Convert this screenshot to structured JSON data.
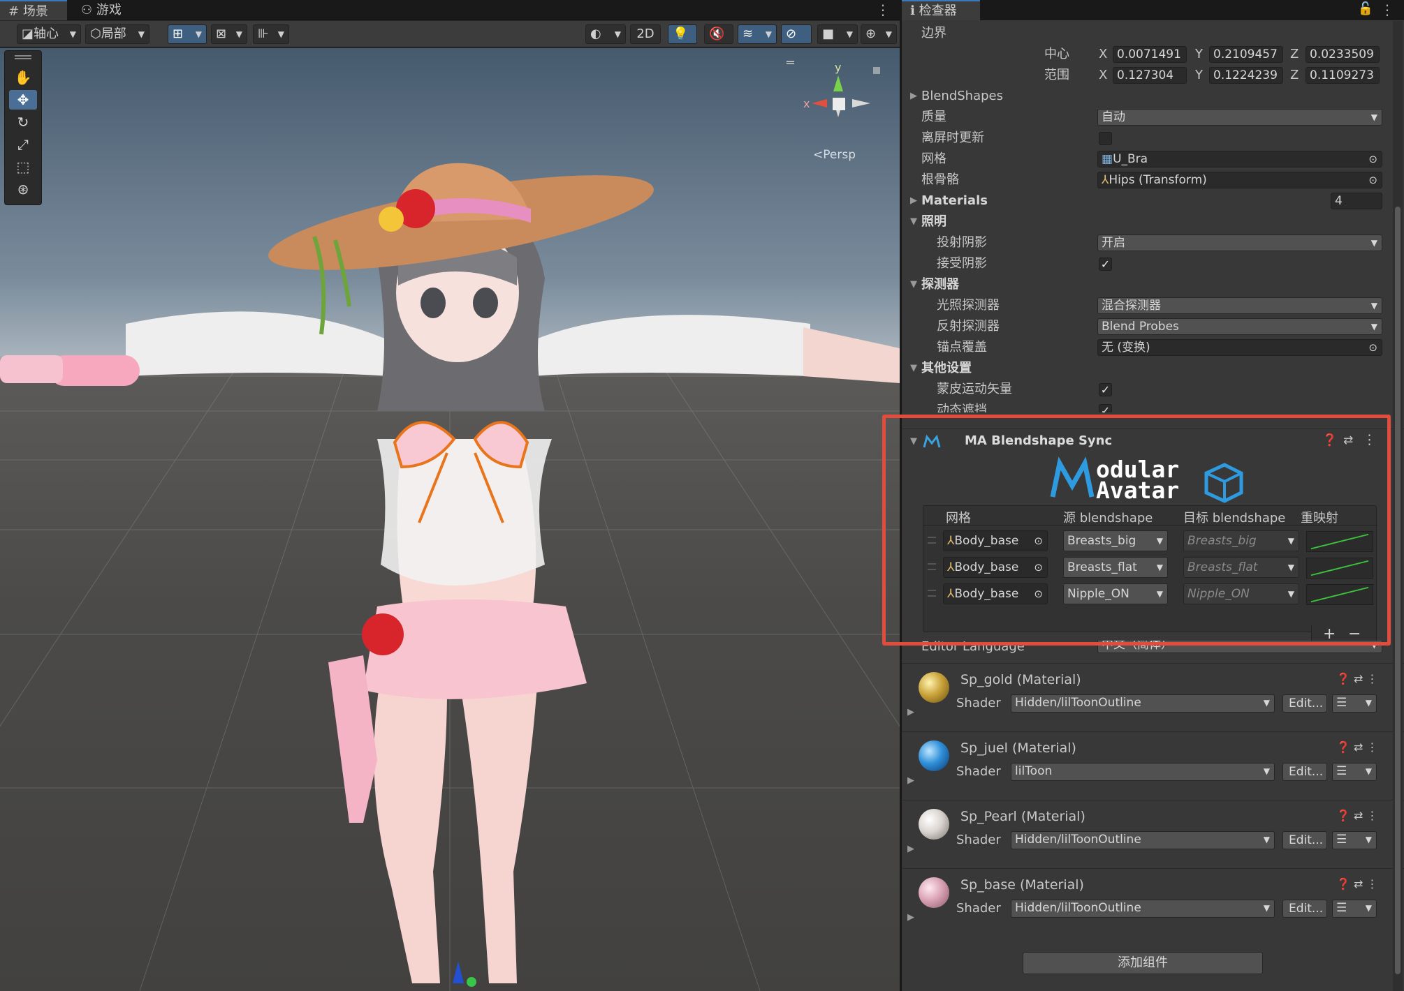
{
  "scene_tabs": {
    "scene": "场景",
    "game": "游戏"
  },
  "toolbar": {
    "pivot": "轴心",
    "local": "局部",
    "mode_2d": "2D"
  },
  "viewport": {
    "persp_label": "Persp",
    "gizmo_y": "y",
    "gizmo_x": "x"
  },
  "inspector": {
    "tab": "检查器",
    "bounds_label": "边界",
    "center_label": "中心",
    "extent_label": "范围",
    "center": {
      "x": "0.0071491",
      "y": "0.2109457",
      "z": "0.0233509"
    },
    "extent": {
      "x": "0.127304",
      "y": "0.1224239",
      "z": "0.1109273"
    },
    "axis": {
      "x": "X",
      "y": "Y",
      "z": "Z"
    },
    "blendshapes": "BlendShapes",
    "quality_label": "质量",
    "quality_value": "自动",
    "offscreen_label": "离屏时更新",
    "mesh_label": "网格",
    "mesh_value": "U_Bra",
    "rootbone_label": "根骨骼",
    "rootbone_value": "Hips (Transform)",
    "materials_label": "Materials",
    "materials_count": "4",
    "lighting_label": "照明",
    "cast_label": "投射阴影",
    "cast_value": "开启",
    "receive_label": "接受阴影",
    "probes_label": "探测器",
    "light_probe_label": "光照探测器",
    "light_probe_value": "混合探测器",
    "refl_probe_label": "反射探测器",
    "refl_probe_value": "Blend Probes",
    "anchor_label": "锚点覆盖",
    "anchor_value": "无 (变换)",
    "other_label": "其他设置",
    "skinned_motion_label": "蒙皮运动矢量",
    "dynamic_occ_label": "动态遮挡",
    "editor_language_label": "Editor Language",
    "editor_language_value": "中文（简体）"
  },
  "ma": {
    "title": "MA Blendshape Sync",
    "logo_line1": "odular",
    "logo_line2": "Avatar",
    "headers": {
      "mesh": "网格",
      "source": "源 blendshape",
      "target": "目标 blendshape",
      "remap": "重映射"
    },
    "rows": [
      {
        "mesh": "Body_base",
        "source": "Breasts_big",
        "target": "Breasts_big"
      },
      {
        "mesh": "Body_base",
        "source": "Breasts_flat",
        "target": "Breasts_flat"
      },
      {
        "mesh": "Body_base",
        "source": "Nipple_ON",
        "target": "Nipple_ON"
      }
    ],
    "plus": "+",
    "minus": "−"
  },
  "materials": [
    {
      "name": "Sp_gold (Material)",
      "shader_label": "Shader",
      "shader": "Hidden/lilToonOutline",
      "edit": "Edit...",
      "color": "#c9a23a"
    },
    {
      "name": "Sp_juel (Material)",
      "shader_label": "Shader",
      "shader": "lilToon",
      "edit": "Edit...",
      "color": "#2f8fd8"
    },
    {
      "name": "Sp_Pearl (Material)",
      "shader_label": "Shader",
      "shader": "Hidden/lilToonOutline",
      "edit": "Edit...",
      "color": "#d9d4cf"
    },
    {
      "name": "Sp_base (Material)",
      "shader_label": "Shader",
      "shader": "Hidden/lilToonOutline",
      "edit": "Edit...",
      "color": "#d9a3b5"
    }
  ],
  "add_component": "添加组件",
  "colors": {
    "highlight": "#e24c3b",
    "accent": "#3a79bb"
  }
}
